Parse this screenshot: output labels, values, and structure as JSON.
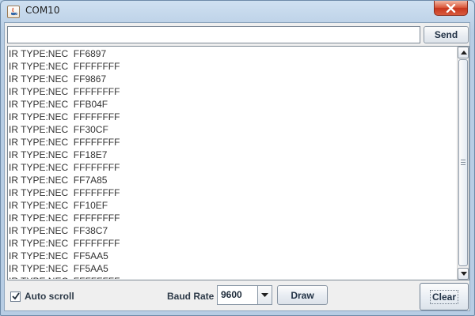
{
  "window": {
    "title": "COM10",
    "app_icon": "java-icon",
    "close_icon": "close-icon"
  },
  "send_bar": {
    "input_value": "",
    "input_placeholder": "",
    "send_label": "Send"
  },
  "log": {
    "lines": [
      "IR TYPE:NEC  FF6897",
      "IR TYPE:NEC  FFFFFFFF",
      "IR TYPE:NEC  FF9867",
      "IR TYPE:NEC  FFFFFFFF",
      "IR TYPE:NEC  FFB04F",
      "IR TYPE:NEC  FFFFFFFF",
      "IR TYPE:NEC  FF30CF",
      "IR TYPE:NEC  FFFFFFFF",
      "IR TYPE:NEC  FF18E7",
      "IR TYPE:NEC  FFFFFFFF",
      "IR TYPE:NEC  FF7A85",
      "IR TYPE:NEC  FFFFFFFF",
      "IR TYPE:NEC  FF10EF",
      "IR TYPE:NEC  FFFFFFFF",
      "IR TYPE:NEC  FF38C7",
      "IR TYPE:NEC  FFFFFFFF",
      "IR TYPE:NEC  FF5AA5",
      "IR TYPE:NEC  FF5AA5",
      "IR TYPE:NEC  FFFFFFFF"
    ],
    "scroll_up_icon": "chevron-up-icon",
    "scroll_down_icon": "chevron-down-icon"
  },
  "bottom_bar": {
    "autoscroll_label": "Auto scroll",
    "autoscroll_checked": true,
    "baud_label": "Baud Rate",
    "baud_value": "9600",
    "draw_label": "Draw",
    "clear_label": "Clear"
  },
  "colors": {
    "window_frame": "#bcd3ea",
    "close_button": "#d9573b",
    "button_text": "#223246"
  }
}
